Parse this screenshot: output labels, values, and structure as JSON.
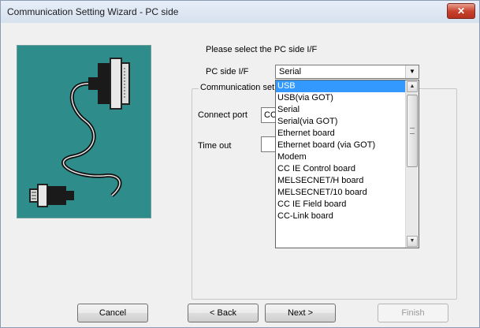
{
  "window": {
    "title": "Communication Setting Wizard - PC side",
    "close_glyph": "✕"
  },
  "prompt": "Please select the PC side I/F",
  "pc_side_if": {
    "label": "PC side I/F",
    "value": "Serial"
  },
  "comm_group": {
    "title": "Communication set"
  },
  "connect_port": {
    "label": "Connect port",
    "value": "CC"
  },
  "timeout": {
    "label": "Time out",
    "value": ""
  },
  "dropdown": {
    "items": [
      {
        "label": "USB",
        "selected": true
      },
      {
        "label": "USB(via GOT)"
      },
      {
        "label": "Serial"
      },
      {
        "label": "Serial(via GOT)"
      },
      {
        "label": "Ethernet board"
      },
      {
        "label": "Ethernet board (via GOT)"
      },
      {
        "label": "Modem"
      },
      {
        "label": "CC IE Control board"
      },
      {
        "label": "MELSECNET/H board"
      },
      {
        "label": "MELSECNET/10 board"
      },
      {
        "label": "CC IE Field board"
      },
      {
        "label": "CC-Link board"
      }
    ]
  },
  "buttons": {
    "cancel": "Cancel",
    "back": "< Back",
    "next": "Next >",
    "finish": "Finish"
  },
  "icons": {
    "illustration": "serial-cable-illustration",
    "arrow": "chevron-down-icon"
  },
  "colors": {
    "illustration_bg": "#2e8c8a",
    "selection": "#3399ff",
    "close_button": "#c8432e"
  }
}
